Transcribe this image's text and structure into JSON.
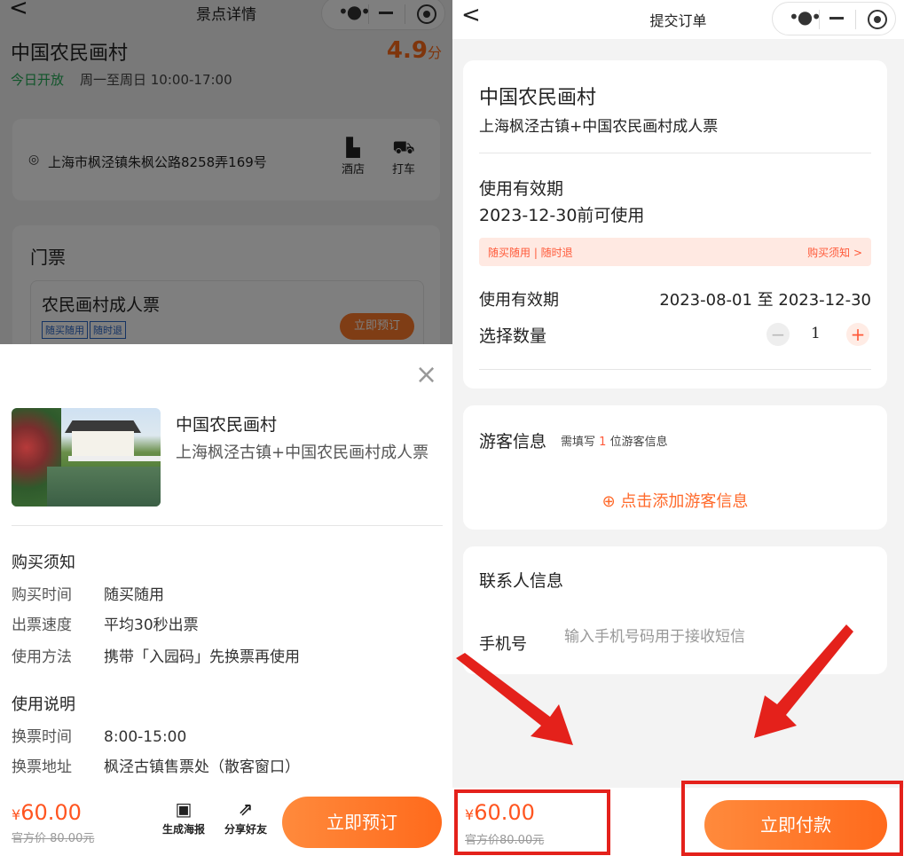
{
  "left": {
    "nav": {
      "back": "<",
      "title": "景点详情"
    },
    "spot": {
      "name": "中国农民画村",
      "score": "4.9",
      "score_unit": "分",
      "open_status": "今日开放",
      "open_hours": "周一至周日 10:00-17:00",
      "address": "上海市枫泾镇朱枫公路8258弄169号",
      "hotel_label": "酒店",
      "taxi_label": "打车"
    },
    "tickets": {
      "heading": "门票",
      "item_name": "农民画村成人票",
      "tags": [
        "随买随用",
        "随时退"
      ],
      "book_label": "立即预订"
    },
    "sheet": {
      "close": "×",
      "product_name": "中国农民画村",
      "product_sub": "上海枫泾古镇+中国农民画村成人票",
      "purchase_title": "购买须知",
      "purchase_rows": [
        {
          "k": "购买时间",
          "v": "随买随用"
        },
        {
          "k": "出票速度",
          "v": "平均30秒出票"
        },
        {
          "k": "使用方法",
          "v": "携带「入园码」先换票再使用"
        }
      ],
      "usage_title": "使用说明",
      "usage_rows": [
        {
          "k": "换票时间",
          "v": "8:00-15:00"
        },
        {
          "k": "换票地址",
          "v": "枫泾古镇售票处（散客窗口）"
        }
      ]
    },
    "footer": {
      "currency": "¥",
      "price": "60.00",
      "orig_price": "官方价 80.00元",
      "poster_label": "生成海报",
      "share_label": "分享好友",
      "book_label": "立即预订"
    }
  },
  "right": {
    "nav": {
      "back": "<",
      "title": "提交订单"
    },
    "order": {
      "name": "中国农民画村",
      "sub": "上海枫泾古镇+中国农民画村成人票",
      "valid_label": "使用有效期",
      "valid_value": "2023-12-30前可使用",
      "notice_left": "随买随用 | 随时退",
      "notice_right": "购买须知 >",
      "date_label": "使用有效期",
      "date_value": "2023-08-01 至 2023-12-30",
      "qty_label": "选择数量",
      "qty": "1"
    },
    "visitor": {
      "title": "游客信息",
      "hint_prefix": "需填写",
      "hint_num": "1",
      "hint_suffix": "位游客信息",
      "add_label": "点击添加游客信息"
    },
    "contact": {
      "title": "联系人信息",
      "phone_label": "手机号",
      "phone_placeholder": "输入手机号码用于接收短信"
    },
    "footer": {
      "currency": "¥",
      "price": "60.00",
      "orig_price": "官方价80.00元",
      "pay_label": "立即付款"
    }
  },
  "colors": {
    "accent": "#ff6a1c",
    "annotation": "#e4211b",
    "open": "#22aa55"
  }
}
